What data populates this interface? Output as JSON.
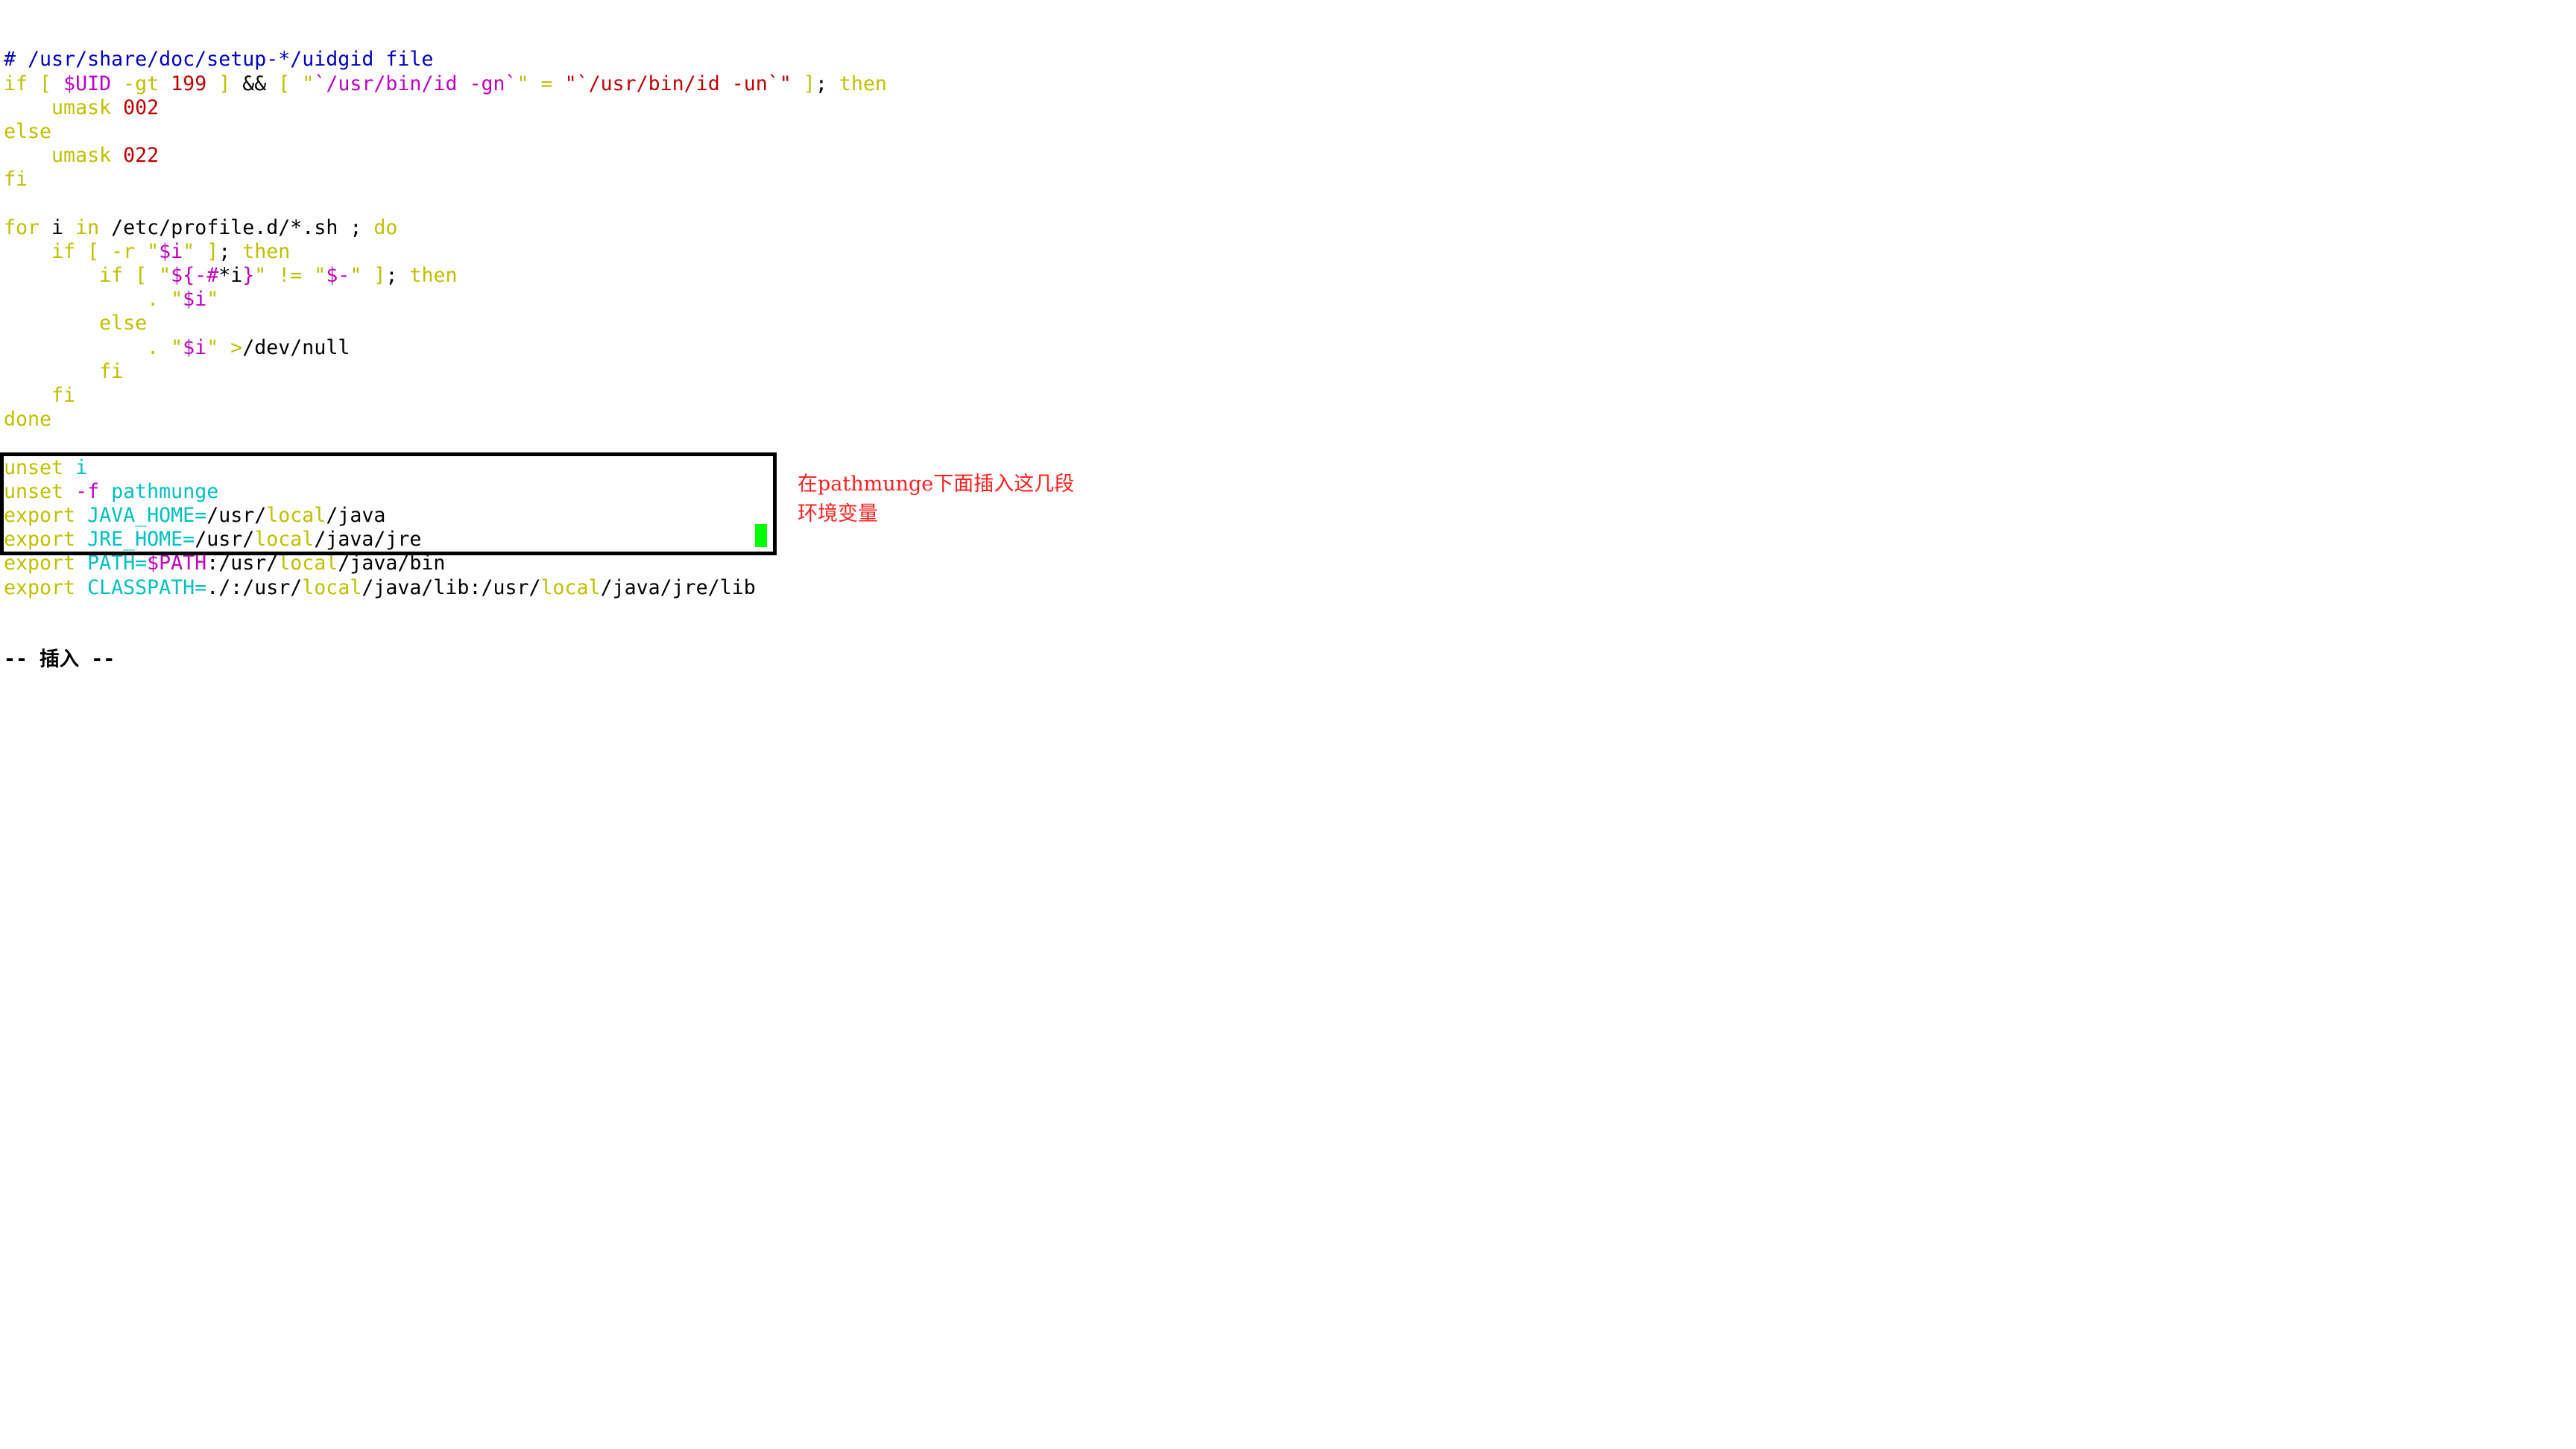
{
  "editor": {
    "mode": "insert",
    "status_line": "-- 插入 --",
    "cursor": {
      "line": 23,
      "column": 64
    },
    "lines": [
      [
        {
          "t": "# /usr/share/doc/setup-*/uidgid file",
          "c": "comment"
        }
      ],
      [
        {
          "t": "if [ ",
          "c": "keyword"
        },
        {
          "t": "$UID",
          "c": "var"
        },
        {
          "t": " -gt ",
          "c": "keyword"
        },
        {
          "t": "199",
          "c": "number"
        },
        {
          "t": " ] ",
          "c": "keyword"
        },
        {
          "t": "&&",
          "c": "plain"
        },
        {
          "t": " [ \"",
          "c": "keyword"
        },
        {
          "t": "`/usr/bin/id -gn`",
          "c": "var"
        },
        {
          "t": "\" = ",
          "c": "keyword"
        },
        {
          "t": "\"`/usr/bin/id -un`\"",
          "c": "string"
        },
        {
          "t": " ]",
          "c": "keyword"
        },
        {
          "t": "; ",
          "c": "plain"
        },
        {
          "t": "then",
          "c": "keyword"
        }
      ],
      [
        {
          "t": "    umask ",
          "c": "keyword"
        },
        {
          "t": "002",
          "c": "number"
        }
      ],
      [
        {
          "t": "else",
          "c": "keyword"
        }
      ],
      [
        {
          "t": "    umask ",
          "c": "keyword"
        },
        {
          "t": "022",
          "c": "number"
        }
      ],
      [
        {
          "t": "fi",
          "c": "keyword"
        }
      ],
      [
        {
          "t": "",
          "c": "plain"
        }
      ],
      [
        {
          "t": "for",
          "c": "keyword"
        },
        {
          "t": " i ",
          "c": "plain"
        },
        {
          "t": "in",
          "c": "keyword"
        },
        {
          "t": " /etc/profile.d/*.sh ; ",
          "c": "plain"
        },
        {
          "t": "do",
          "c": "keyword"
        }
      ],
      [
        {
          "t": "    if [ -r \"",
          "c": "keyword"
        },
        {
          "t": "$i",
          "c": "var"
        },
        {
          "t": "\" ]",
          "c": "keyword"
        },
        {
          "t": "; ",
          "c": "plain"
        },
        {
          "t": "then",
          "c": "keyword"
        }
      ],
      [
        {
          "t": "        if [ \"",
          "c": "keyword"
        },
        {
          "t": "${-#",
          "c": "var"
        },
        {
          "t": "*i",
          "c": "plain"
        },
        {
          "t": "}",
          "c": "var"
        },
        {
          "t": "\" != \"",
          "c": "keyword"
        },
        {
          "t": "$-",
          "c": "var"
        },
        {
          "t": "\" ]",
          "c": "keyword"
        },
        {
          "t": "; ",
          "c": "plain"
        },
        {
          "t": "then",
          "c": "keyword"
        }
      ],
      [
        {
          "t": "            . \"",
          "c": "keyword"
        },
        {
          "t": "$i",
          "c": "var"
        },
        {
          "t": "\"",
          "c": "keyword"
        }
      ],
      [
        {
          "t": "        else",
          "c": "keyword"
        }
      ],
      [
        {
          "t": "            . \"",
          "c": "keyword"
        },
        {
          "t": "$i",
          "c": "var"
        },
        {
          "t": "\" >",
          "c": "keyword"
        },
        {
          "t": "/dev/null",
          "c": "plain"
        }
      ],
      [
        {
          "t": "        fi",
          "c": "keyword"
        }
      ],
      [
        {
          "t": "    fi",
          "c": "keyword"
        }
      ],
      [
        {
          "t": "done",
          "c": "keyword"
        }
      ],
      [
        {
          "t": "",
          "c": "plain"
        }
      ],
      [
        {
          "t": "unset ",
          "c": "keyword"
        },
        {
          "t": "i",
          "c": "ident"
        }
      ],
      [
        {
          "t": "unset ",
          "c": "keyword"
        },
        {
          "t": "-f",
          "c": "var"
        },
        {
          "t": " ",
          "c": "plain"
        },
        {
          "t": "pathmunge",
          "c": "ident"
        }
      ],
      [
        {
          "t": "export ",
          "c": "keyword"
        },
        {
          "t": "JAVA_HOME=",
          "c": "ident"
        },
        {
          "t": "/usr/",
          "c": "plain"
        },
        {
          "t": "local",
          "c": "keyword"
        },
        {
          "t": "/java",
          "c": "plain"
        }
      ],
      [
        {
          "t": "export ",
          "c": "keyword"
        },
        {
          "t": "JRE_HOME=",
          "c": "ident"
        },
        {
          "t": "/usr/",
          "c": "plain"
        },
        {
          "t": "local",
          "c": "keyword"
        },
        {
          "t": "/java/jre",
          "c": "plain"
        }
      ],
      [
        {
          "t": "export ",
          "c": "keyword"
        },
        {
          "t": "PATH=",
          "c": "ident"
        },
        {
          "t": "$PATH",
          "c": "var"
        },
        {
          "t": ":/usr/",
          "c": "plain"
        },
        {
          "t": "local",
          "c": "keyword"
        },
        {
          "t": "/java/bin",
          "c": "plain"
        }
      ],
      [
        {
          "t": "export ",
          "c": "keyword"
        },
        {
          "t": "CLASSPATH=",
          "c": "ident"
        },
        {
          "t": "./:/usr/",
          "c": "plain"
        },
        {
          "t": "local",
          "c": "keyword"
        },
        {
          "t": "/java/lib:/usr/",
          "c": "plain"
        },
        {
          "t": "local",
          "c": "keyword"
        },
        {
          "t": "/java/jre/lib",
          "c": "plain"
        }
      ]
    ]
  },
  "annotation": {
    "lines": [
      "在pathmunge下面插入这几段",
      "环境变量"
    ],
    "color": "#ff2020"
  },
  "colors": {
    "comment": "#0000c0",
    "keyword": "#c0c000",
    "var": "#c000c0",
    "number": "#c00000",
    "string": "#c00000",
    "ident": "#00c0c0",
    "plain": "#000000",
    "cursor": "#00ff00",
    "highlight_box": "#000000"
  }
}
